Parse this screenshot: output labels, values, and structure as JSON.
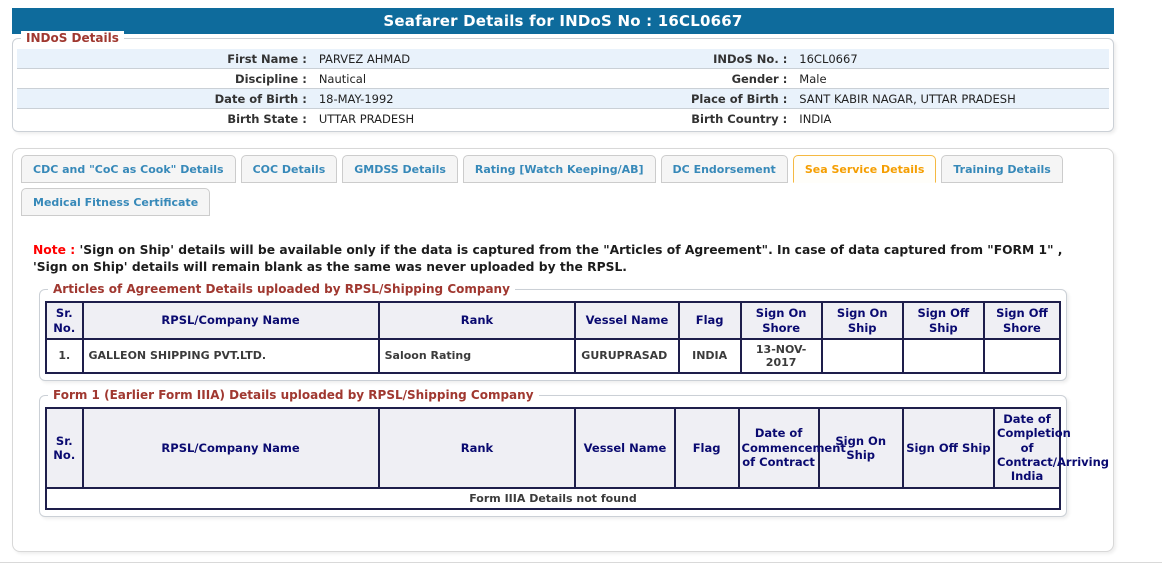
{
  "header": {
    "title": "Seafarer Details for INDoS No : 16CL0667"
  },
  "colors": {
    "title_bar": "#0E6B9C",
    "legend_red": "#A03830",
    "tab_blue": "#3789B9",
    "tab_active_orange": "#F59E00",
    "row_stripe": "#E9F2FB",
    "table_border_navy": "#1E1E4B",
    "header_text_navy": "#0A0A70",
    "note_red": "#FF0000",
    "error_red": "#E60000"
  },
  "indos_details": {
    "legend": "INDoS Details",
    "rows": [
      {
        "label1": "First Name :",
        "value1": "PARVEZ AHMAD",
        "label2": "INDoS No. :",
        "value2": "16CL0667"
      },
      {
        "label1": "Discipline :",
        "value1": "Nautical",
        "label2": "Gender :",
        "value2": "Male"
      },
      {
        "label1": "Date of Birth :",
        "value1": "18-MAY-1992",
        "label2": "Place of Birth :",
        "value2": "SANT KABIR NAGAR, UTTAR PRADESH"
      },
      {
        "label1": "Birth State :",
        "value1": "UTTAR PRADESH",
        "label2": "Birth Country :",
        "value2": "INDIA"
      }
    ]
  },
  "tabs": {
    "items": [
      {
        "label": "CDC and \"CoC as Cook\" Details",
        "active": false
      },
      {
        "label": "COC Details",
        "active": false
      },
      {
        "label": "GMDSS Details",
        "active": false
      },
      {
        "label": "Rating [Watch Keeping/AB]",
        "active": false
      },
      {
        "label": "DC Endorsement",
        "active": false
      },
      {
        "label": "Sea Service Details",
        "active": true
      },
      {
        "label": "Training Details",
        "active": false
      },
      {
        "label": "Medical Fitness Certificate",
        "active": false
      }
    ]
  },
  "note": {
    "prefix": "Note :",
    "text": " 'Sign on Ship' details will be available only if the data is captured from the \"Articles of Agreement\". In case of data captured from \"FORM 1\" , 'Sign on Ship' details will remain blank as the same was never uploaded by the RPSL."
  },
  "agreement_table": {
    "caption": "Articles of Agreement Details uploaded by RPSL/Shipping Company",
    "headers": [
      "Sr. No.",
      "RPSL/Company Name",
      "Rank",
      "Vessel Name",
      "Flag",
      "Sign On Shore",
      "Sign On Ship",
      "Sign Off Ship",
      "Sign Off Shore"
    ],
    "rows": [
      [
        "1.",
        "GALLEON SHIPPING PVT.LTD.",
        "Saloon Rating",
        "GURUPRASAD",
        "INDIA",
        "13-NOV-2017",
        "",
        "",
        ""
      ]
    ]
  },
  "form1_table": {
    "caption": "Form 1 (Earlier Form IIIA) Details uploaded by RPSL/Shipping Company",
    "headers": [
      "Sr. No.",
      "RPSL/Company Name",
      "Rank",
      "Vessel Name",
      "Flag",
      "Date of Commencement of Contract",
      "Sign On Ship",
      "Sign Off Ship",
      "Date of Completion of Contract/Arriving India"
    ],
    "empty_message": "Form IIIA Details not found"
  }
}
